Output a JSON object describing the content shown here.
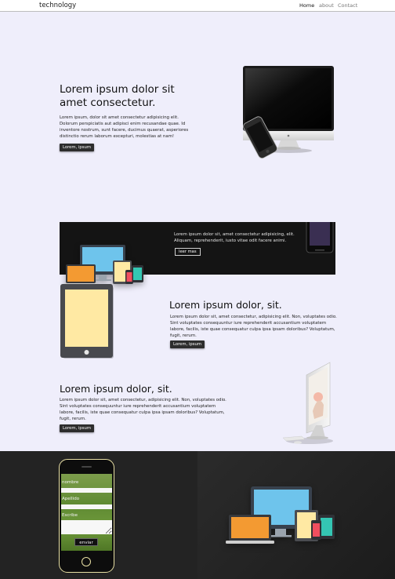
{
  "nav": {
    "brand": "technology",
    "links": [
      "Home",
      "about",
      "Contact"
    ]
  },
  "hero": {
    "title_line1": "Lorem ipsum dolor sit",
    "title_line2": "amet consectetur.",
    "body_lines": [
      "Lorem ipsum, dolor sit amet consectetur adipisicing elit.",
      "Dolorum perspiciatis aut adipisci enim recusandae quae. Id",
      "inventore nostrum, sunt facere, ducimus quaerat, asperiores",
      "distinctio rerum laborum excepturi, molestias at nam!"
    ],
    "button": "Lorem, ipsum"
  },
  "band": {
    "text_lines": [
      "Lorem ipsum dolor sit, amet consectetur adipisicing, elit.",
      "Aliquam, reprehenderit, iusto vitae odit facere animi."
    ],
    "button": "leer mas"
  },
  "section2": {
    "title": "Lorem ipsum dolor, sit.",
    "body_lines": [
      "Lorem ipsum dolor sit, amet consectetur, adipisicing elit. Non, voluptates odio.",
      "Sint voluptates consequuntur iure reprehenderit accusantium voluptatem",
      "labore, facilis, iste quae consequatur culpa ipsa ipsam doloribus? Voluptatum,",
      "fugit, rerum."
    ],
    "button": "Lorem, ipsum"
  },
  "section3": {
    "title": "Lorem ipsum dolor, sit.",
    "body_lines": [
      "Lorem ipsum dolor sit, amet consectetur, adipisicing elit. Non, voluptates odio.",
      "Sint voluptates consequuntur iure reprehenderit accusantium voluptatem",
      "labore, facilis, iste quae consequatur culpa ipsa ipsam doloribus? Voluptatum,",
      "fugit, rerum."
    ],
    "button": "Lorem, ipsum"
  },
  "form": {
    "field1_label": "nombre",
    "field2_label": "Apellido",
    "field3_label": "Escribe",
    "submit": "enviar"
  },
  "colors": {
    "page_bg": "#efeefb",
    "dark": "#141414",
    "footer": "#232323",
    "device_blue": "#6ec4ec",
    "device_orange": "#f39a32",
    "device_yellow": "#ffe9a3",
    "device_teal": "#34c6b3",
    "device_red": "#f04e5e"
  }
}
